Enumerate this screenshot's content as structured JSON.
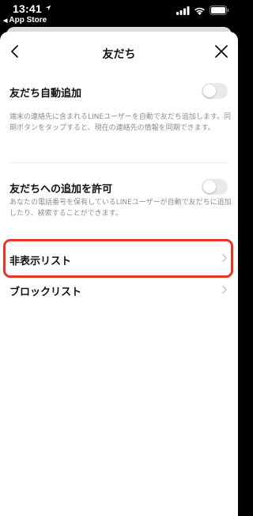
{
  "status_bar": {
    "time": "13:41",
    "back_app_label": "App Store",
    "back_app_arrow": "◀",
    "icons": [
      "location-arrow-icon",
      "signal-icon",
      "wifi-icon",
      "battery-icon"
    ]
  },
  "nav": {
    "title": "友だち",
    "back_icon": "chevron-left-icon",
    "close_icon": "close-icon"
  },
  "settings": {
    "auto_add": {
      "title": "友だち自動追加",
      "description": "端末の連絡先に含まれるLINEユーザーを自動で友だち追加します。同期ボタンをタップすると、現在の連絡先の情報を同期できます。",
      "enabled": false
    },
    "allow_add": {
      "title": "友だちへの追加を許可",
      "description": "あなたの電話番号を保有しているLINEユーザーが自動で友だちに追加したり、検索することができます。",
      "enabled": false
    },
    "hidden_list": {
      "label": "非表示リスト"
    },
    "block_list": {
      "label": "ブロックリスト"
    }
  },
  "colors": {
    "highlight_border": "#e8352a",
    "toggle_off": "#e9e9eb",
    "secondary_text": "#8e8e93"
  }
}
